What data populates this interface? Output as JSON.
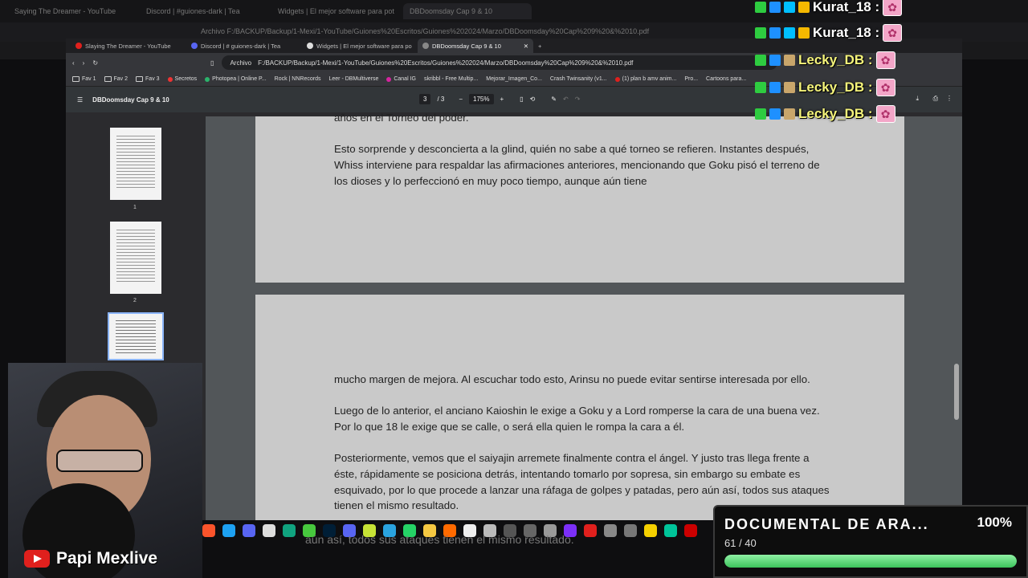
{
  "bg_browser": {
    "tabs": [
      "Saying The Dreamer - YouTube",
      "Discord | #guiones-dark | Tea",
      "Widgets | El mejor software para pot",
      "DBDoomsday Cap 9 & 10"
    ],
    "address": "Archivo   F:/BACKUP/Backup/1-Mexi/1-YouTube/Guiones%20Escritos/Guiones%202024/Marzo/DBDoomsday%20Cap%209%20&%2010.pdf"
  },
  "browser": {
    "tabs": [
      {
        "label": "Slaying The Dreamer - YouTube",
        "color": "#e0201d"
      },
      {
        "label": "Discord | # guiones-dark | Tea",
        "color": "#5865f2"
      },
      {
        "label": "Widgets | El mejor software para po",
        "color": "#dddddd"
      },
      {
        "label": "DBDoomsday Cap 9 & 10",
        "color": "#888888",
        "active": true
      }
    ],
    "new_tab": "+",
    "address_prefix": "Archivo",
    "url": "F:/BACKUP/Backup/1-Mexi/1-YouTube/Guiones%20Escritos/Guiones%202024/Marzo/DBDoomsday%20Cap%209%20&%2010.pdf",
    "bookmarks": [
      "Fav 1",
      "Fav 2",
      "Fav 3",
      "Secretos",
      "Photopea | Online P...",
      "Rock | NNRecords",
      "Leer - DBMultiverse",
      "Canal IG",
      "skribbl - Free Multip...",
      "Mejorar_Imagen_Co...",
      "Crash Twinsanity (v1...",
      "(1) plan b amv anim...",
      "Pro...",
      "Cartoons para..."
    ]
  },
  "pdf": {
    "title": "DBDoomsday Cap 9 & 10",
    "page_current": "3",
    "page_total": "/ 3",
    "zoom": "175%",
    "thumbs": [
      "1",
      "2"
    ],
    "page1_tail": "años en el Torneo del poder.",
    "page1_para": "Esto sorprende y desconcierta a la glind, quién no sabe a qué torneo se refieren. Instantes después, Whiss interviene para respaldar las afirmaciones anteriores, mencionando que Goku pisó el terreno de los dioses y lo perfeccionó en muy poco tiempo, aunque aún tiene",
    "page2_para1": "mucho margen de mejora. Al escuchar todo esto, Arinsu no puede evitar sentirse interesada por ello.",
    "page2_para2": "Luego de lo anterior, el anciano Kaioshin le exige a Goku y a Lord romperse la cara de una buena vez. Por lo que 18 le exige que se calle, o será ella quien le rompa la cara a él.",
    "page2_para3": "Posteriormente, vemos que el saiyajin arremete finalmente contra el ángel. Y justo tras llega frente a éste, rápidamente se posiciona detrás, intentando tomarlo por sopresa, sin embargo su embate es esquivado, por lo que procede a lanzar una ráfaga de golpes y patadas, pero aún así, todos sus ataques tienen el mismo resultado."
  },
  "chat": [
    {
      "name": "Kurat_18 :",
      "style": "w"
    },
    {
      "name": "Kurat_18 :",
      "style": "w"
    },
    {
      "name": "Lecky_DB :",
      "style": "y"
    },
    {
      "name": "Lecky_DB :",
      "style": "y"
    },
    {
      "name": "Lecky_DB :",
      "style": "y"
    }
  ],
  "streamer": {
    "name": "Papi Mexlive"
  },
  "ghost_text": "aún así, todos sus ataques tienen el mismo resultado.",
  "goal": {
    "title": "DOCUMENTAL DE ARA...",
    "percent": "100%",
    "count": "61 / 40",
    "progress": 1.0
  },
  "colors": {
    "accent_green": "#3cc45c",
    "selected_thumb": "#8ab4f8"
  }
}
